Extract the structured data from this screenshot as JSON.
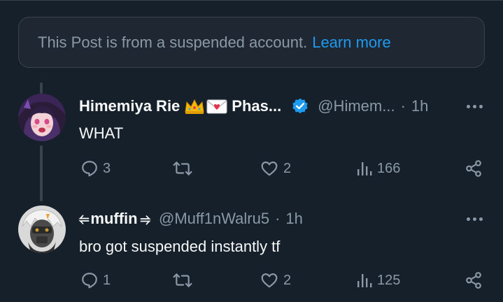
{
  "notice": {
    "text": "This Post is from a suspended account.",
    "link": "Learn more"
  },
  "posts": [
    {
      "display_name": "Himemiya Rie",
      "name_suffix": "Phas...",
      "emojis": [
        "crown-emoji",
        "love-letter-emoji"
      ],
      "verified": true,
      "handle": "@Himem...",
      "dot": "·",
      "time": "1h",
      "text": "WHAT",
      "replies": "3",
      "reposts": "",
      "likes": "2",
      "views": "166"
    },
    {
      "display_name_prefix": "⥢",
      "display_name": "muffin",
      "display_name_suffix": "⥤",
      "handle": "@Muff1nWalru5",
      "dot": "·",
      "time": "1h",
      "text": "bro got suspended instantly tf",
      "replies": "1",
      "reposts": "",
      "likes": "2",
      "views": "125"
    }
  ],
  "colors": {
    "background": "#15202b",
    "card": "#1e2732",
    "border": "#38444d",
    "muted": "#8b98a5",
    "accent": "#1d9bf0",
    "text": "#f7f9f9"
  }
}
